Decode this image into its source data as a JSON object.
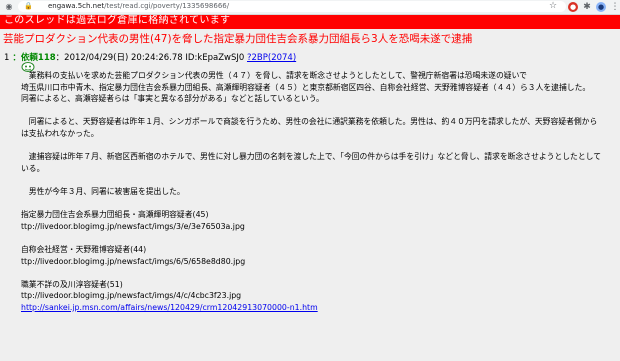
{
  "browser": {
    "url_prefix": "engawa.5ch.net",
    "url_path": "/test/read.cgi/poverty/1335698666/"
  },
  "banner": {
    "text": "このスレッドは過去ログ倉庫に格納されています"
  },
  "thread": {
    "title": "芸能プロダクション代表の男性(47)を脅した指定暴力団住吉会系暴力団組長ら3人を恐喝未遂で逮捕"
  },
  "post": {
    "number": "1",
    "name": "：依頼118",
    "date_id": "：2012/04/29(日) 20:24:26.78 ID:kEpaZwSJ0",
    "be": "?2BP(2074)",
    "lines": [
      "　業務料の支払いを求めた芸能プロダクション代表の男性（４７）を脅し、請求を断念させようとしたとして、警視庁新宿署は恐喝未遂の疑いで",
      "埼玉県川口市中青木、指定暴力団住吉会系暴力団組長、高瀬輝明容疑者（４５）と東京都新宿区四谷、自称会社経営、天野雅博容疑者（４４）ら３人を逮捕した。",
      "同署によると、高瀬容疑者らは「事実と異なる部分がある」などと話しているという。",
      "",
      "　同署によると、天野容疑者は昨年１月、シンガポールで商談を行うため、男性の会社に通訳業務を依頼した。男性は、約４０万円を請求したが、天野容疑者側から",
      "は支払われなかった。",
      "",
      "　逮捕容疑は昨年７月、新宿区西新宿のホテルで、男性に対し暴力団の名刺を渡した上で、「今回の件からは手を引け」などと脅し、請求を断念させようとしたとして",
      "いる。",
      "",
      "　男性が今年３月、同署に被害届を提出した。",
      "",
      "指定暴力団住吉会系暴力団組長・高瀬輝明容疑者(45)",
      "ttp://livedoor.blogimg.jp/newsfact/imgs/3/e/3e76503a.jpg",
      "",
      "自称会社経営・天野雅博容疑者(44)",
      "ttp://livedoor.blogimg.jp/newsfact/imgs/6/5/658e8d80.jpg",
      "",
      "職業不詳の及川淳容疑者(51)",
      "ttp://livedoor.blogimg.jp/newsfact/imgs/4/c/4cbc3f23.jpg"
    ],
    "source_link": "http://sankei.jp.msn.com/affairs/news/120429/crm12042913070000-n1.htm"
  },
  "icons": {
    "lock": "lock-icon",
    "star": "star-icon",
    "ext1": "extension-red-icon",
    "ext2": "puzzle-icon",
    "ext3": "profile-icon",
    "menu": "kebab-menu-icon"
  },
  "colors": {
    "banner": "#ff0000",
    "title": "#ff0000",
    "name": "#008800",
    "link": "#0000ee"
  }
}
